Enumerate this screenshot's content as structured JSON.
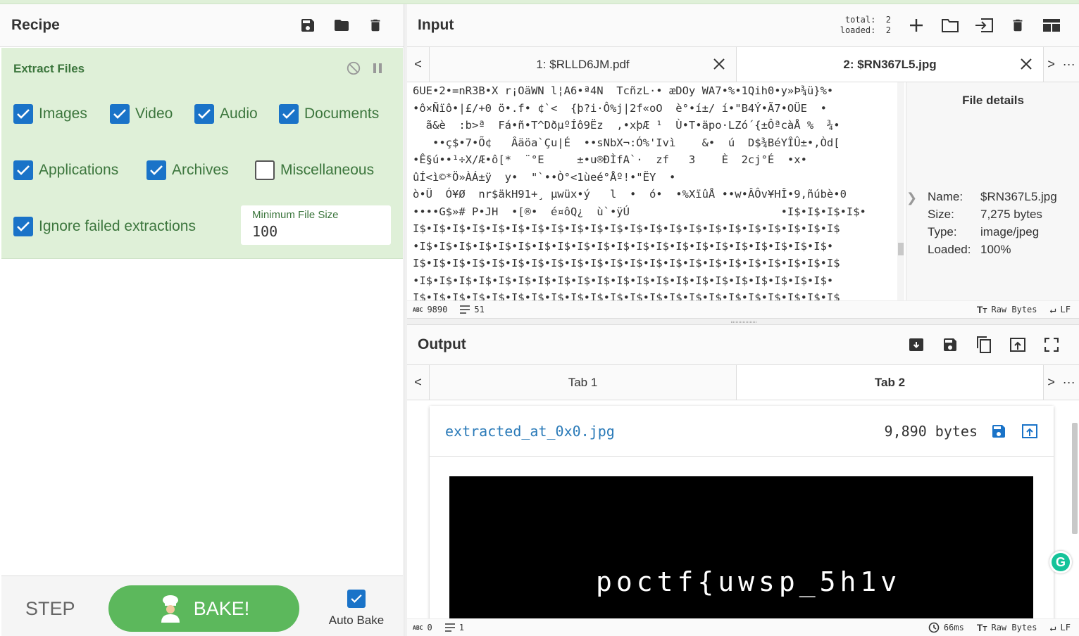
{
  "recipe": {
    "title": "Recipe",
    "operation": {
      "name": "Extract Files",
      "checkboxes": {
        "images": {
          "label": "Images",
          "checked": true
        },
        "video": {
          "label": "Video",
          "checked": true
        },
        "audio": {
          "label": "Audio",
          "checked": true
        },
        "documents": {
          "label": "Documents",
          "checked": true
        },
        "applications": {
          "label": "Applications",
          "checked": true
        },
        "archives": {
          "label": "Archives",
          "checked": true
        },
        "miscellaneous": {
          "label": "Miscellaneous",
          "checked": false
        },
        "ignore_failed": {
          "label": "Ignore failed extractions",
          "checked": true
        }
      },
      "min_file_size": {
        "label": "Minimum File Size",
        "value": "100"
      }
    },
    "step_label": "STEP",
    "bake_label": "BAKE!",
    "auto_bake": {
      "label": "Auto Bake",
      "checked": true
    }
  },
  "input": {
    "title": "Input",
    "total_label": "total:",
    "total_value": "2",
    "loaded_label": "loaded:",
    "loaded_value": "2",
    "tabs": [
      {
        "label": "1: $RLLD6JM.pdf",
        "active": false
      },
      {
        "label": "2: $RN367L5.jpg",
        "active": true
      }
    ],
    "lines": [
      "6UE•2•=nR3B•X r¡OäWN l¦A6•ª4N  TcñzL·• æDOy WA7•%•1Qih0•y»Þ¾ü}%•",
      "•ô×Ñïô•|£/+0 ö•.f• ¢`<  {þ?i·Ô%j|2f«oO  è°•í±/ í•\"B4Ý•Ã7•OÜE  •",
      "  ã&è  :b>ª  Fá•ñ•T^DðµºÍô9Ëz  ,•xþÆ ¹  Ù•T•äpo·LZó´{±ÔªcàÅ %  ¾•",
      "   ••ç$•7•Õ¢   Âäöa`Çu|É  ••sNbX¬:Ó%'Ivì    &•  ú  D$¾BéYÎÛ±•,Òd[",
      "•Ê§ú••¹÷X/Æ•ô[*  ¨°E     ±•u®ÐÌfA`·  zf   3    È  2cj°É  •x•",
      "ûÍ<ì©*Ö»ÀÁ±ÿ  y•  \"`••Ò°<1ùeé°Åº!•\"ËY  •",
      "ò•Ü  Ó¥Ø  nr$äkH91+¸ µwüx•ý   l  •  ó•  •%XïûÅ ••w•ÂÔv¥HÎ•9,ñúbè•0",
      "••••G$»# P•JH  •[®•  é¤ôQ¿  ù`•ÿÚ                       •I$•I$•I$•I$•",
      "I$•I$•I$•I$•I$•I$•I$•I$•I$•I$•I$•I$•I$•I$•I$•I$•I$•I$•I$•I$•I$•I$",
      "•I$•I$•I$•I$•I$•I$•I$•I$•I$•I$•I$•I$•I$•I$•I$•I$•I$•I$•I$•I$•I$•",
      "I$•I$•I$•I$•I$•I$•I$•I$•I$•I$•I$•I$•I$•I$•I$•I$•I$•I$•I$•I$•I$•I$",
      "•I$•I$•I$•I$•I$•I$•I$•I$•I$•I$•I$•I$•I$•I$•I$•I$•I$•I$•I$•I$•I$•",
      "I$•I$•I$•I$•I$•I$•I$•I$•I$•I$•I$•I$•I$•I$•I$•I$•I$•I$•I$•I$•I$•I$"
    ],
    "file_details": {
      "title": "File details",
      "name_label": "Name:",
      "name": "$RN367L5.jpg",
      "size_label": "Size:",
      "size": "7,275 bytes",
      "type_label": "Type:",
      "type": "image/jpeg",
      "loaded_label": "Loaded:",
      "loaded": "100%"
    },
    "status": {
      "length": "9890",
      "lines": "51",
      "encoding": "Raw Bytes",
      "eol": "LF"
    }
  },
  "output": {
    "title": "Output",
    "tabs": [
      {
        "label": "Tab 1",
        "active": false
      },
      {
        "label": "Tab 2",
        "active": true
      }
    ],
    "file": {
      "name": "extracted_at_0x0.jpg",
      "size": "9,890 bytes",
      "image_text": "poctf{uwsp_5h1v"
    },
    "status": {
      "length": "0",
      "lines": "1",
      "time": "66ms",
      "encoding": "Raw Bytes",
      "eol": "LF"
    }
  },
  "nav": {
    "prev": "<",
    "next": ">",
    "more": "···"
  },
  "colors": {
    "accent": "#1a73c8",
    "op_bg": "#dff0d8",
    "op_text": "#3c763d",
    "bake": "#5cb85c",
    "link": "#2a7ab8"
  }
}
